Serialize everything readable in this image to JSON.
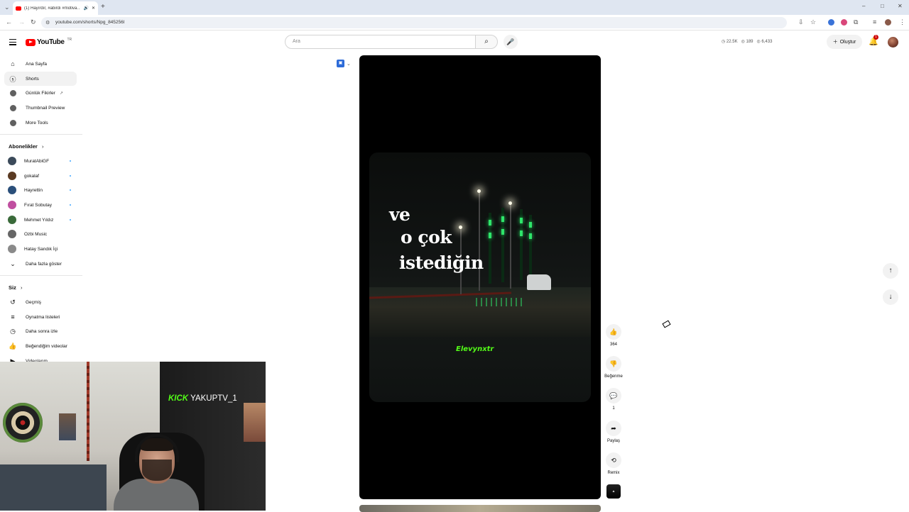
{
  "browser": {
    "tab_title": "(1) Hayırdır, #abirdı #motiva…",
    "url": "youtube.com/shorts/Npg_845256l",
    "new_tab": "+",
    "window_controls": [
      "–",
      "□",
      "✕"
    ]
  },
  "header": {
    "logo_text": "YouTube",
    "country_code": "TR",
    "search_placeholder": "Ara",
    "stats": [
      "22.5K",
      "189",
      "6,433"
    ],
    "create_label": "Oluştur",
    "notification_count": "1"
  },
  "sidebar": {
    "main": [
      {
        "label": "Ana Sayfa",
        "icon": "home-icon"
      },
      {
        "label": "Shorts",
        "icon": "shorts-icon"
      },
      {
        "label": "Günlük Fikirler",
        "icon": "app-icon"
      },
      {
        "label": "Thumbnail Preview",
        "icon": "app-icon"
      },
      {
        "label": "More Tools",
        "icon": "app-icon"
      }
    ],
    "subscriptions_title": "Abonelikler",
    "subscriptions": [
      {
        "label": "MuratAbiGF",
        "color": "#3b4a5a"
      },
      {
        "label": "gokalaf",
        "color": "#5a3a22"
      },
      {
        "label": "Hayrettin",
        "color": "#2a4f7a"
      },
      {
        "label": "Fırat Sobutay",
        "color": "#c04fa0"
      },
      {
        "label": "Mehmet Yıldız",
        "color": "#3a6a3a"
      },
      {
        "label": "Ozbi Music",
        "color": "#666666"
      },
      {
        "label": "Hatay Sandık İçi",
        "color": "#8a8a8a"
      }
    ],
    "show_more": "Daha fazla göster",
    "you_title": "Siz",
    "you_items": [
      {
        "label": "Geçmiş",
        "icon": "history-icon"
      },
      {
        "label": "Oynatma listeleri",
        "icon": "playlist-icon"
      },
      {
        "label": "Daha sonra izle",
        "icon": "watch-later-icon"
      },
      {
        "label": "Beğendiğim videolar",
        "icon": "like-icon"
      },
      {
        "label": "Videolarım",
        "icon": "video-icon"
      }
    ]
  },
  "overlay": {
    "kick_brand": "KICK",
    "streamer": "YAKUPTV_1"
  },
  "short": {
    "caption_lines": [
      "ve",
      "o çok",
      "istediğin"
    ],
    "watermark": "Elevynxtr",
    "actions": {
      "like_count": "364",
      "dislike_label": "Beğenme",
      "comment_count": "1",
      "share_label": "Paylaş",
      "remix_label": "Remix"
    }
  }
}
